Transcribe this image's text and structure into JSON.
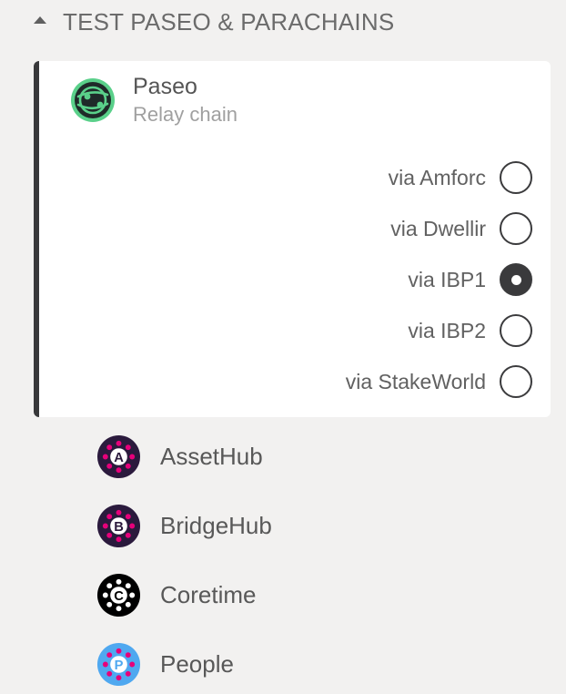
{
  "section": {
    "title": "TEST PASEO & PARACHAINS",
    "collapse_icon": "triangle-up-icon"
  },
  "relay": {
    "name": "Paseo",
    "subtitle": "Relay chain",
    "logo_icon": "paseo-logo",
    "accent_color": "#5ad08a",
    "selected_provider": "via IBP1",
    "providers": [
      {
        "label": "via Amforc",
        "selected": false
      },
      {
        "label": "via Dwellir",
        "selected": false
      },
      {
        "label": "via IBP1",
        "selected": true
      },
      {
        "label": "via IBP2",
        "selected": false
      },
      {
        "label": "via StakeWorld",
        "selected": false
      }
    ]
  },
  "parachains": [
    {
      "label": "AssetHub",
      "letter": "A",
      "icon": "assethub-logo",
      "bg": "#2b1a3d"
    },
    {
      "label": "BridgeHub",
      "letter": "B",
      "icon": "bridgehub-logo",
      "bg": "#2b1a3d"
    },
    {
      "label": "Coretime",
      "letter": "C",
      "icon": "coretime-logo",
      "bg": "#000000"
    },
    {
      "label": "People",
      "letter": "P",
      "icon": "people-logo",
      "bg": "#4fa8f0"
    }
  ]
}
